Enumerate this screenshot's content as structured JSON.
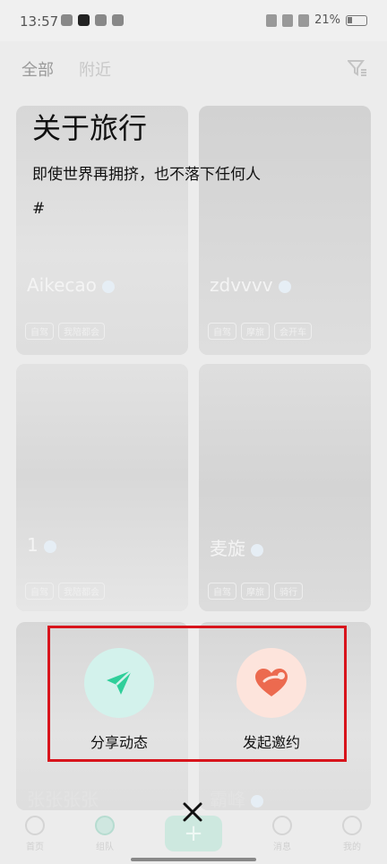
{
  "status_bar": {
    "time": "13:57",
    "battery": "21%"
  },
  "tabs": [
    {
      "label": "全部",
      "active": true
    },
    {
      "label": "附近",
      "active": false
    }
  ],
  "overlay": {
    "title": "关于旅行",
    "subtitle": "即使世界再拥挤，也不落下任何人",
    "hash": "#"
  },
  "cards": [
    {
      "name": "Aikecao",
      "chips": [
        "自驾",
        "我陪都会"
      ]
    },
    {
      "name": "zdvvvv",
      "chips": [
        "自驾",
        "摩旅",
        "会开车"
      ]
    },
    {
      "name": "1",
      "chips": [
        "自驾",
        "我陪都会"
      ]
    },
    {
      "name": "麦旋",
      "chips": [
        "自驾",
        "摩旅",
        "骑行"
      ]
    },
    {
      "name": "张张张张"
    },
    {
      "name": "霸峰"
    }
  ],
  "actions": {
    "share": {
      "label": "分享动态",
      "icon": "paper-plane-icon",
      "bg": "#d3f2ec",
      "color": "#2fcf9a"
    },
    "invite": {
      "label": "发起邀约",
      "icon": "heart-icon",
      "bg": "#fde4dc",
      "color": "#ec6a4f"
    }
  },
  "bottom_nav": [
    {
      "label": "首页"
    },
    {
      "label": "组队"
    },
    {
      "label": "+"
    },
    {
      "label": "消息"
    },
    {
      "label": "我的"
    }
  ],
  "colors": {
    "highlight_border": "#d8141c",
    "accent": "#2fcf9a"
  }
}
